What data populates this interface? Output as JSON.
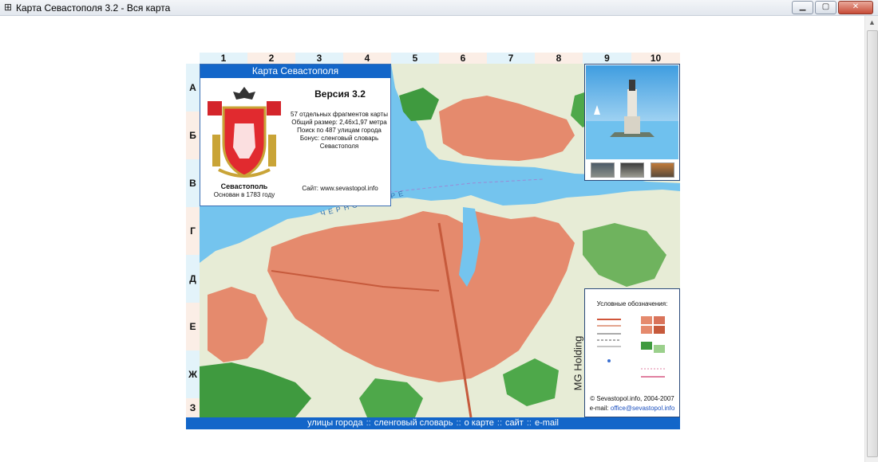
{
  "window": {
    "title": "Карта Севастополя 3.2 - Вся карта",
    "icon": "grid-app-icon"
  },
  "grid": {
    "columns": [
      "1",
      "2",
      "3",
      "4",
      "5",
      "6",
      "7",
      "8",
      "9",
      "10"
    ],
    "rows": [
      "А",
      "Б",
      "В",
      "Г",
      "Д",
      "Е",
      "Ж",
      "З"
    ]
  },
  "info_panel": {
    "title": "Карта Севастополя",
    "city_name": "Севастополь",
    "founded": "Основан в 1783 году",
    "version": "Версия 3.2",
    "lines": [
      "57 отдельных фрагментов карты",
      "Общий размер: 2,46х1,97 метра",
      "Поиск по 487 улицам города",
      "Бонус: сленговый словарь",
      "Севастополя"
    ],
    "site": "Сайт: www.sevastopol.info"
  },
  "map_labels": {
    "sea": "ЧЕРНОЕ МОРЕ"
  },
  "legend": {
    "title": "Условные обозначения:",
    "copyright": "© Sevastopol.info, 2004-2007",
    "email_label": "e-mail:",
    "email": "office@sevastopol.info",
    "brand": "MG Holding"
  },
  "nav": {
    "items": [
      "улицы города",
      "сленговый словарь",
      "о карте",
      "сайт",
      "e-mail"
    ],
    "separator": "::"
  },
  "colors": {
    "accent": "#1366c9",
    "sea": "#74c4ee",
    "urban": "#e58a6d",
    "green": "#3f9a3f"
  }
}
